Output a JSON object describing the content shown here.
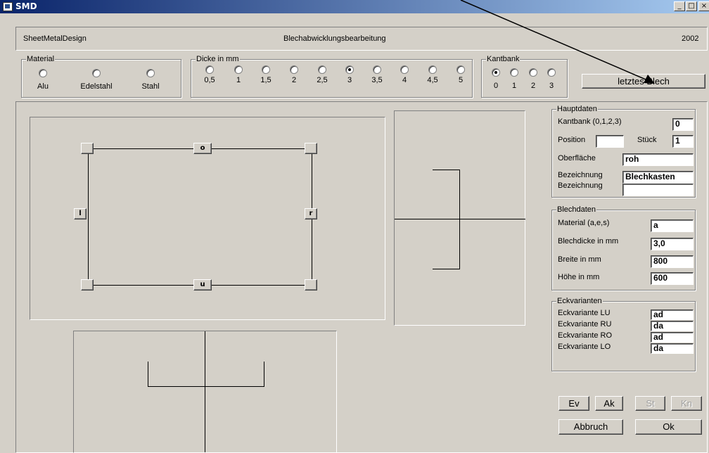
{
  "window": {
    "title": "SMD",
    "minimize": "_",
    "maximize": "□",
    "close": "×"
  },
  "header": {
    "left": "SheetMetalDesign",
    "center": "Blechabwicklungsbearbeitung",
    "right": "2002"
  },
  "material": {
    "legend": "Material",
    "options": [
      "Alu",
      "Edelstahl",
      "Stahl"
    ],
    "selected": null
  },
  "dicke": {
    "legend": "Dicke in mm",
    "options": [
      "0,5",
      "1",
      "1,5",
      "2",
      "2,5",
      "3",
      "3,5",
      "4",
      "4,5",
      "5"
    ],
    "selected": "3"
  },
  "kantbank": {
    "legend": "Kantbank",
    "options": [
      "0",
      "1",
      "2",
      "3"
    ],
    "selected": "0"
  },
  "letztes_blech_label": "letztes Blech",
  "edges": {
    "top": "o",
    "left": "l",
    "right": "r",
    "bottom": "u"
  },
  "hauptdaten": {
    "legend": "Hauptdaten",
    "kantbank_label": "Kantbank (0,1,2,3)",
    "kantbank_value": "0",
    "position_label": "Position",
    "position_value": "",
    "stueck_label": "Stück",
    "stueck_value": "1",
    "oberflaeche_label": "Oberfläche",
    "oberflaeche_value": "roh",
    "bezeichnung1_label": "Bezeichnung",
    "bezeichnung1_value": "Blechkasten",
    "bezeichnung2_label": "Bezeichnung",
    "bezeichnung2_value": ""
  },
  "blechdaten": {
    "legend": "Blechdaten",
    "material_label": "Material (a,e,s)",
    "material_value": "a",
    "dicke_label": "Blechdicke in mm",
    "dicke_value": "3,0",
    "breite_label": "Breite in mm",
    "breite_value": "800",
    "hoehe_label": "Höhe in mm",
    "hoehe_value": "600"
  },
  "eckvarianten": {
    "legend": "Eckvarianten",
    "items": [
      {
        "label": "Eckvariante LU",
        "value": "ad"
      },
      {
        "label": "Eckvariante RU",
        "value": "da"
      },
      {
        "label": "Eckvariante RO",
        "value": "ad"
      },
      {
        "label": "Eckvariante LO",
        "value": "da"
      }
    ]
  },
  "buttons": {
    "ev": "Ev",
    "ak": "Ak",
    "st": "St",
    "kn": "Kn",
    "abbruch": "Abbruch",
    "ok": "Ok"
  }
}
